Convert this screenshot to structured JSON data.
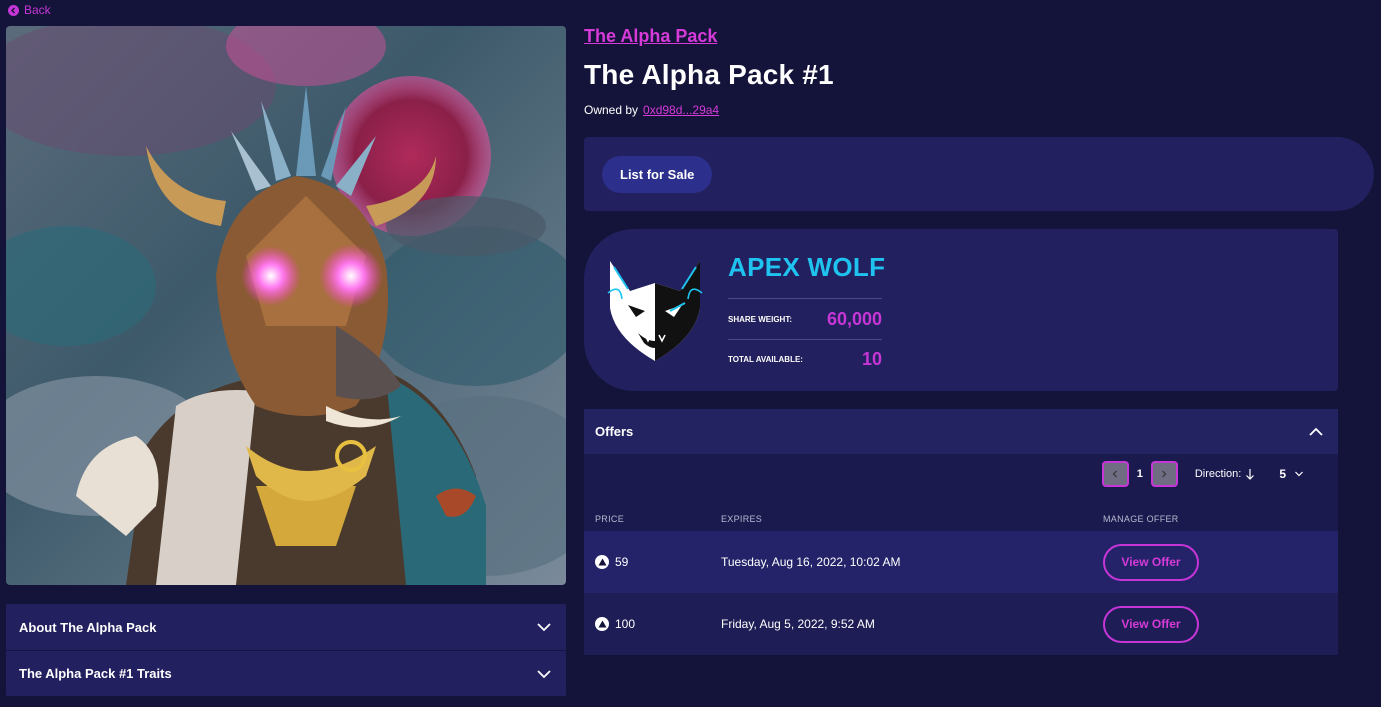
{
  "nav": {
    "back_label": "Back"
  },
  "collection": {
    "name": "The Alpha Pack"
  },
  "nft": {
    "title": "The Alpha Pack #1",
    "owned_by_label": "Owned by",
    "owner_address": "0xd98d...29a4"
  },
  "actions": {
    "list_for_sale": "List for Sale"
  },
  "tier": {
    "name": "APEX WOLF",
    "share_weight_label": "SHARE WEIGHT:",
    "share_weight_value": "60,000",
    "total_available_label": "TOTAL AVAILABLE:",
    "total_available_value": "10",
    "logo_icon": "wolf-head-icon"
  },
  "offers": {
    "title": "Offers",
    "page": "1",
    "direction_label": "Direction:",
    "page_size": "5",
    "columns": {
      "price": "PRICE",
      "expires": "EXPIRES",
      "manage": "MANAGE OFFER"
    },
    "rows": [
      {
        "price": "59",
        "expires": "Tuesday, Aug 16, 2022, 10:02 AM",
        "action": "View Offer"
      },
      {
        "price": "100",
        "expires": "Friday, Aug 5, 2022, 9:52 AM",
        "action": "View Offer"
      }
    ]
  },
  "accordions": [
    {
      "label": "About The Alpha Pack"
    },
    {
      "label": "The Alpha Pack #1 Traits"
    }
  ],
  "colors": {
    "background": "#14143a",
    "panel": "#22205e",
    "accent_pink": "#c636d6",
    "accent_cyan": "#1fc3ef"
  }
}
